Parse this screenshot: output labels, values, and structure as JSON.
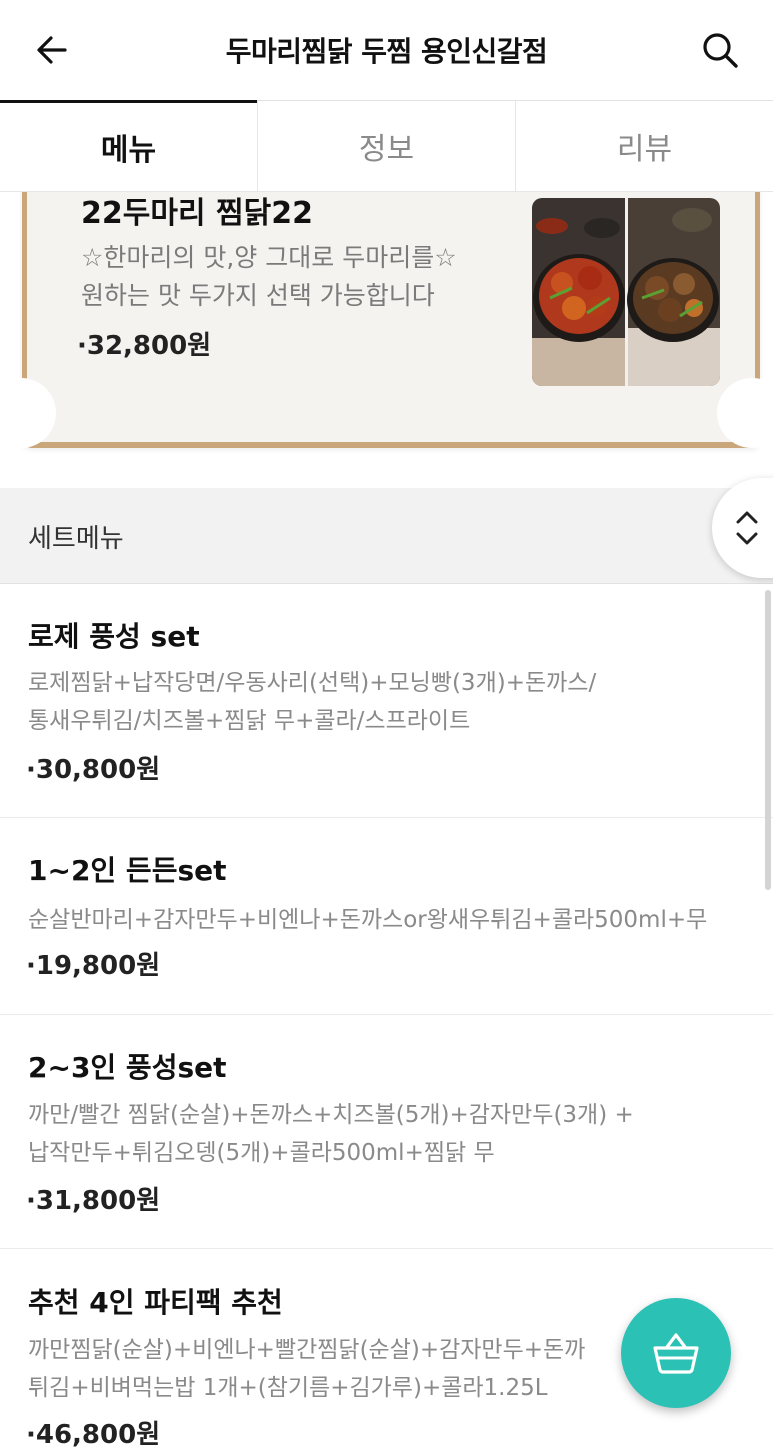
{
  "header": {
    "title": "두마리찜닭 두찜 용인신갈점",
    "back_icon": "arrow-left-icon",
    "search_icon": "search-icon"
  },
  "tabs": [
    {
      "label": "메뉴",
      "active": true
    },
    {
      "label": "정보",
      "active": false
    },
    {
      "label": "리뷰",
      "active": false
    }
  ],
  "promo": {
    "title": "22두마리 찜닭22",
    "desc_line1": "☆한마리의 맛,양 그대로 두마리를☆",
    "desc_line2": "원하는 맛 두가지 선택 가능합니다",
    "price": "·32,800원"
  },
  "section": {
    "title": "세트메뉴",
    "toggle_icon": "chevron-up-down-icon"
  },
  "menu_items": [
    {
      "name": " 로제 풍성 set",
      "desc_line1": "로제찜닭+납작당면/우동사리(선택)+모닝빵(3개)+돈까스/",
      "desc_line2": "통새우튀김/치즈볼+찜닭 무+콜라/스프라이트",
      "price": "·30,800원"
    },
    {
      "name": "1~2인 든든set",
      "desc_line1": "순살반마리+감자만두+비엔나+돈까스or왕새우튀김+콜라500ml+무",
      "desc_line2": "",
      "price": "·19,800원"
    },
    {
      "name": "2~3인 풍성set",
      "desc_line1": "까만/빨간 찜닭(순살)+돈까스+치즈볼(5개)+감자만두(3개) +",
      "desc_line2": "납작만두+튀김오뎅(5개)+콜라500ml+찜닭 무",
      "price": "·31,800원"
    },
    {
      "name": "추천 4인 파티팩 추천",
      "desc_line1": "까만찜닭(순살)+비엔나+빨간찜닭(순살)+감자만두+돈까",
      "desc_line2": "튀김+비벼먹는밥 1개+(참기름+김가루)+콜라1.25L",
      "price": "·46,800원"
    }
  ],
  "cart": {
    "icon": "shopping-basket-icon"
  },
  "colors": {
    "accent": "#2bc1b5",
    "frame": "#c9a77b"
  }
}
